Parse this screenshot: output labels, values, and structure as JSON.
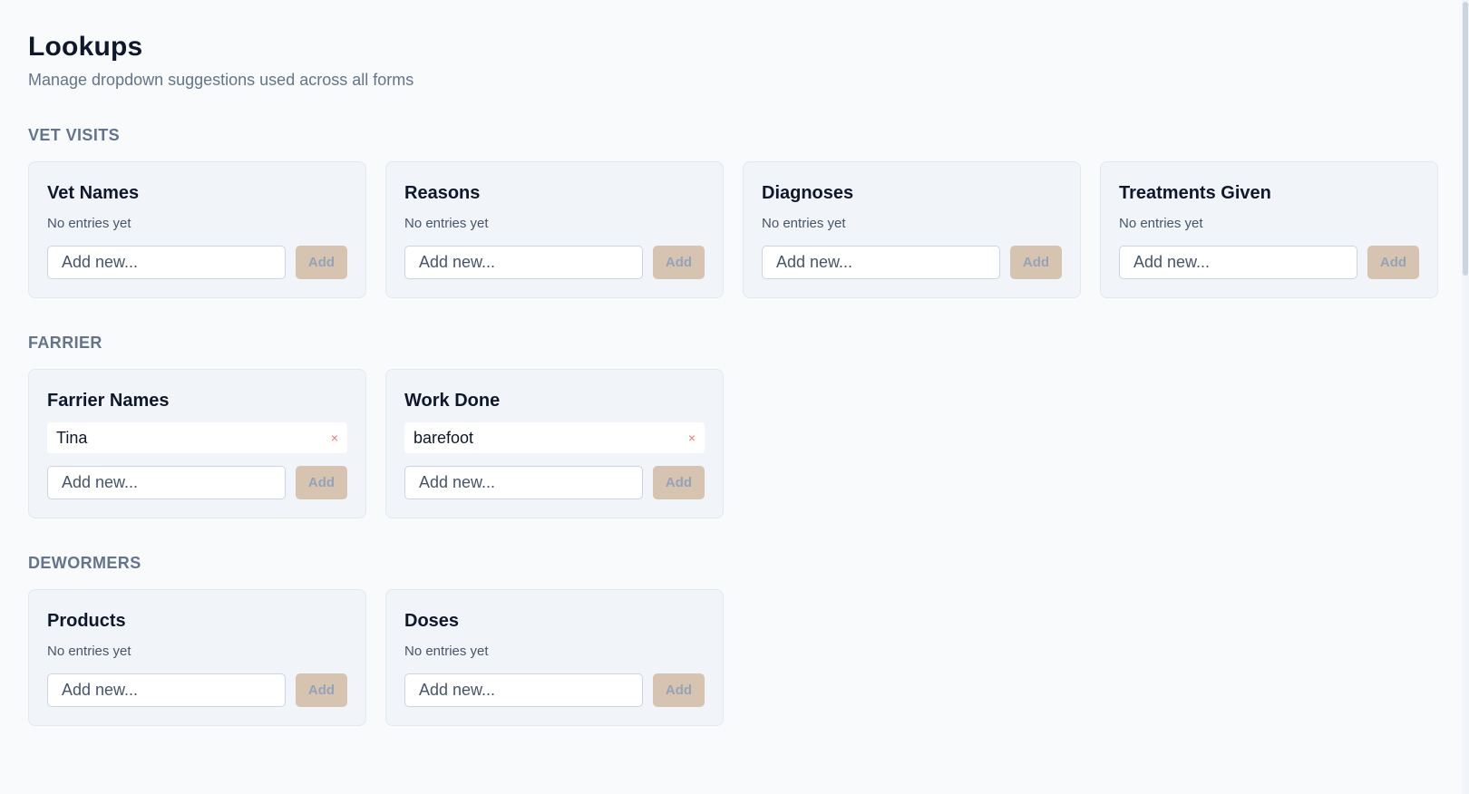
{
  "page": {
    "title": "Lookups",
    "subtitle": "Manage dropdown suggestions used across all forms"
  },
  "common": {
    "empty_text": "No entries yet",
    "add_placeholder": "Add new...",
    "add_label": "Add",
    "remove_glyph": "×"
  },
  "sections": [
    {
      "title": "VET VISITS",
      "cards": [
        {
          "title": "Vet Names",
          "entries": []
        },
        {
          "title": "Reasons",
          "entries": []
        },
        {
          "title": "Diagnoses",
          "entries": []
        },
        {
          "title": "Treatments Given",
          "entries": []
        }
      ]
    },
    {
      "title": "FARRIER",
      "cards": [
        {
          "title": "Farrier Names",
          "entries": [
            "Tina"
          ]
        },
        {
          "title": "Work Done",
          "entries": [
            "barefoot"
          ]
        }
      ]
    },
    {
      "title": "DEWORMERS",
      "cards": [
        {
          "title": "Products",
          "entries": []
        },
        {
          "title": "Doses",
          "entries": []
        }
      ]
    }
  ],
  "colors": {
    "background": "#f8fafc",
    "card_background": "#f1f5f9",
    "add_button": "#d6c4b0",
    "remove_icon": "#f87171"
  }
}
